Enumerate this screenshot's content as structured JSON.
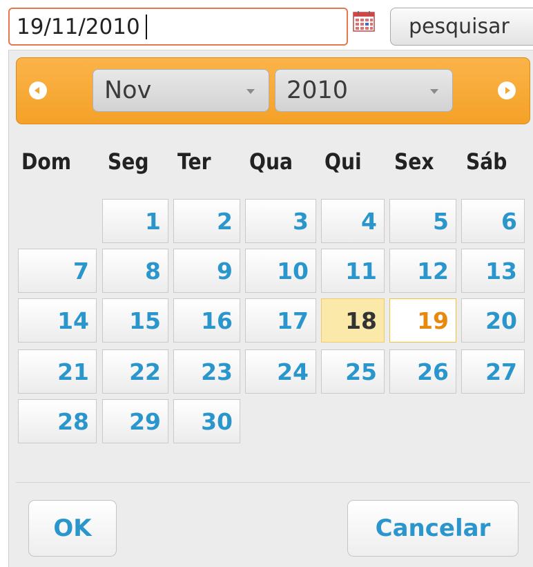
{
  "date_input": {
    "value": "19/11/2010"
  },
  "search_button": {
    "label": "pesquisar"
  },
  "calendar": {
    "month_select": "Nov",
    "year_select": "2010",
    "weekdays": [
      "Dom",
      "Seg",
      "Ter",
      "Qua",
      "Qui",
      "Sex",
      "Sáb"
    ],
    "first_weekday_index": 1,
    "days_in_month": 30,
    "today": 18,
    "selected": 19,
    "ok_label": "OK",
    "cancel_label": "Cancelar"
  },
  "colors": {
    "header_orange": "#f4a128",
    "day_text_blue": "#2a96cc",
    "today_bg": "#fbe9a9",
    "selected_text": "#e8890f",
    "input_border": "#e6774a"
  }
}
